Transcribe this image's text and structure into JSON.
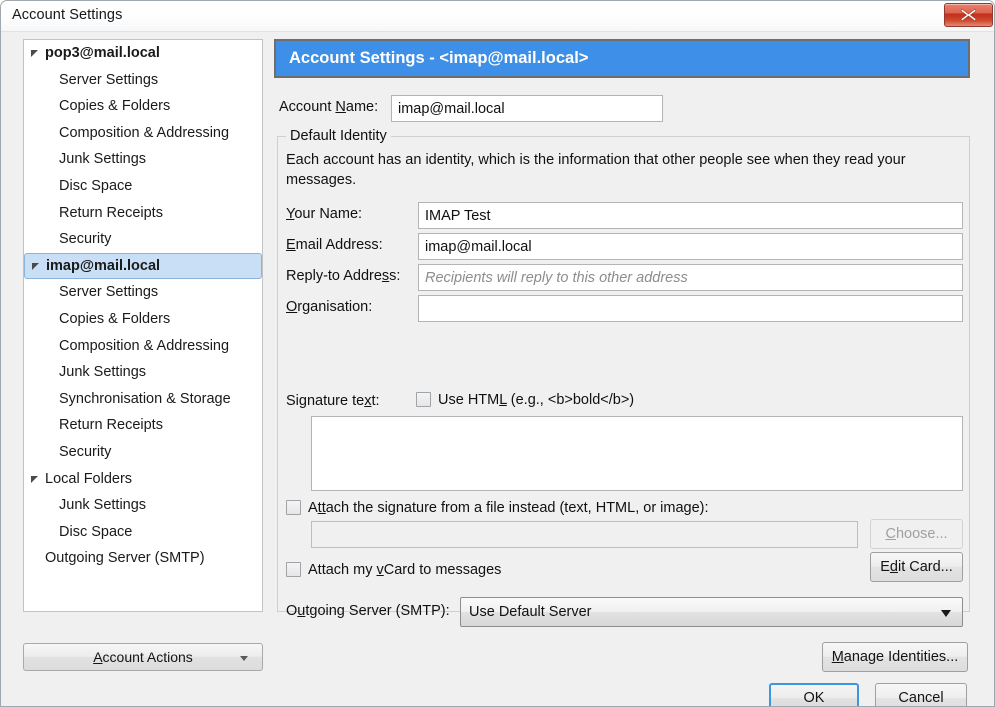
{
  "window": {
    "title": "Account Settings",
    "close_icon": "close-icon",
    "close_label": "X"
  },
  "colors": {
    "header_blue": "#3d8fe8",
    "selection_blue": "#c9dff5",
    "focus_ring_blue": "#3d97e0",
    "close_red": "#c02c15",
    "dialog_background": "#f0f0f0"
  },
  "sidebar": {
    "items": [
      {
        "label": "pop3@mail.local",
        "type": "account",
        "twisty": true,
        "selected": false
      },
      {
        "label": "Server Settings",
        "type": "child",
        "twisty": false,
        "selected": false
      },
      {
        "label": "Copies & Folders",
        "type": "child",
        "twisty": false,
        "selected": false
      },
      {
        "label": "Composition & Addressing",
        "type": "child",
        "twisty": false,
        "selected": false
      },
      {
        "label": "Junk Settings",
        "type": "child",
        "twisty": false,
        "selected": false
      },
      {
        "label": "Disc Space",
        "type": "child",
        "twisty": false,
        "selected": false
      },
      {
        "label": "Return Receipts",
        "type": "child",
        "twisty": false,
        "selected": false
      },
      {
        "label": "Security",
        "type": "child",
        "twisty": false,
        "selected": false
      },
      {
        "label": "imap@mail.local",
        "type": "account",
        "twisty": true,
        "selected": true
      },
      {
        "label": "Server Settings",
        "type": "child",
        "twisty": false,
        "selected": false
      },
      {
        "label": "Copies & Folders",
        "type": "child",
        "twisty": false,
        "selected": false
      },
      {
        "label": "Composition & Addressing",
        "type": "child",
        "twisty": false,
        "selected": false
      },
      {
        "label": "Junk Settings",
        "type": "child",
        "twisty": false,
        "selected": false
      },
      {
        "label": "Synchronisation & Storage",
        "type": "child",
        "twisty": false,
        "selected": false
      },
      {
        "label": "Return Receipts",
        "type": "child",
        "twisty": false,
        "selected": false
      },
      {
        "label": "Security",
        "type": "child",
        "twisty": false,
        "selected": false
      },
      {
        "label": "Local Folders",
        "type": "folders",
        "twisty": true,
        "selected": false
      },
      {
        "label": "Junk Settings",
        "type": "child",
        "twisty": false,
        "selected": false
      },
      {
        "label": "Disc Space",
        "type": "child",
        "twisty": false,
        "selected": false
      },
      {
        "label": "Outgoing Server (SMTP)",
        "type": "plain",
        "twisty": false,
        "selected": false
      }
    ],
    "account_actions": {
      "label": "Account Actions",
      "accesskey": "A",
      "caret_icon": "chevron-down-icon"
    }
  },
  "panel": {
    "header_title": "Account Settings - <imap@mail.local>",
    "account_name": {
      "label_before": "Account ",
      "accesskey": "N",
      "label_after": "ame:",
      "value": "imap@mail.local"
    },
    "identity": {
      "legend": "Default Identity",
      "description": "Each account has an identity, which is the information that other people see when they read your messages.",
      "fields": [
        {
          "name": "your-name",
          "label_before": "",
          "accesskey": "Y",
          "label_after": "our Name:",
          "value": "IMAP Test",
          "placeholder": ""
        },
        {
          "name": "email-address",
          "label_before": "",
          "accesskey": "E",
          "label_after": "mail Address:",
          "value": "imap@mail.local",
          "placeholder": ""
        },
        {
          "name": "reply-to-address",
          "label_before": "Reply-to Addre",
          "accesskey": "s",
          "label_after": "s:",
          "value": "",
          "placeholder": "Recipients will reply to this other address"
        },
        {
          "name": "organisation",
          "label_before": "",
          "accesskey": "O",
          "label_after": "rganisation:",
          "value": "",
          "placeholder": ""
        }
      ],
      "signature": {
        "label_before": "Signature te",
        "accesskey": "x",
        "label_after": "t:",
        "use_html": {
          "label_before": "Use HTM",
          "accesskey": "L",
          "label_after": " (e.g., <b>bold</b>)",
          "checked": false
        },
        "text_value": "",
        "attach_file": {
          "label_before": "A",
          "accesskey": "tt",
          "label_after": "ach the signature from a file instead (text, HTML, or image):",
          "checked": false
        },
        "file_path": "",
        "file_placeholder": "",
        "choose_button": {
          "label_before": "",
          "accesskey": "C",
          "label_after": "hoose...",
          "disabled": true
        }
      },
      "vcard": {
        "label_before": "Attach my ",
        "accesskey": "v",
        "label_after": "Card to messages",
        "checked": false,
        "edit_button": {
          "label_before": "E",
          "accesskey": "d",
          "label_after": "it Card..."
        }
      },
      "smtp": {
        "label_before": "O",
        "accesskey": "u",
        "label_after": "tgoing Server (SMTP):",
        "selected_option": "Use Default Server",
        "caret_icon": "chevron-down-icon"
      }
    }
  },
  "footer": {
    "manage_identities": {
      "label_before": "",
      "accesskey": "M",
      "label_after": "anage Identities..."
    },
    "ok": {
      "label": "OK",
      "focused": true
    },
    "cancel": {
      "label": "Cancel"
    }
  }
}
